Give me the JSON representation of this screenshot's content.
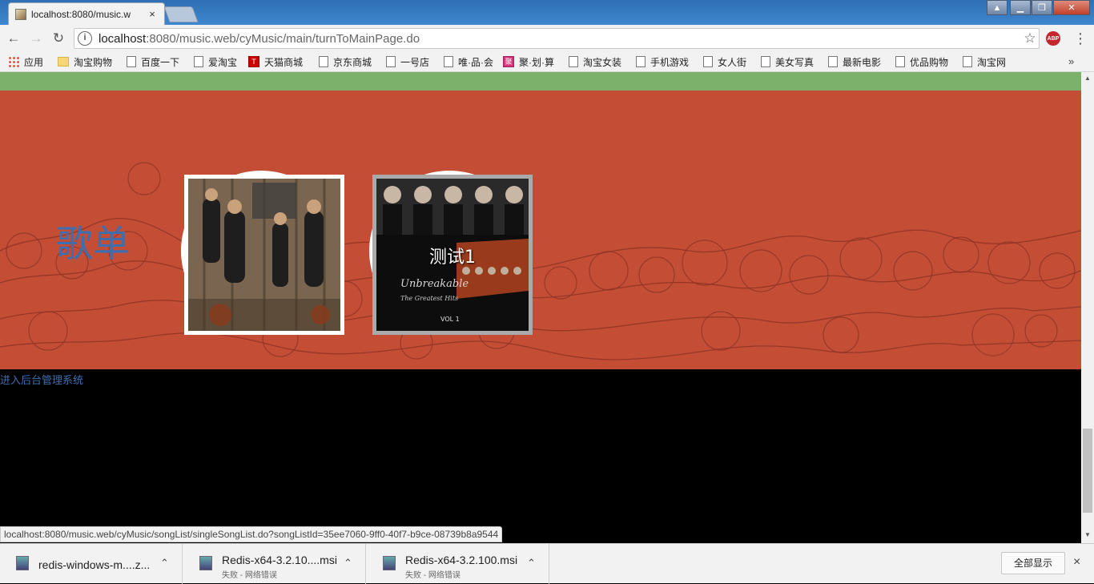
{
  "browser": {
    "tab_title": "localhost:8080/music.w",
    "tab_close": "×",
    "url_host": "localhost",
    "url_rest": ":8080/music.web/cyMusic/main/turnToMainPage.do",
    "abp_label": "ABP",
    "menu_icon": "⋮",
    "star_icon": "☆"
  },
  "bookmarks": {
    "items": [
      {
        "label": "应用",
        "icon": "apps-icon"
      },
      {
        "label": "淘宝购物",
        "icon": "folder-icon"
      },
      {
        "label": "百度一下",
        "icon": "page-icon"
      },
      {
        "label": "爱淘宝",
        "icon": "page-icon"
      },
      {
        "label": "天猫商城",
        "icon": "tmall-icon"
      },
      {
        "label": "京东商城",
        "icon": "page-icon"
      },
      {
        "label": "一号店",
        "icon": "page-icon"
      },
      {
        "label": "唯·品·会",
        "icon": "page-icon"
      },
      {
        "label": "聚·划·算",
        "icon": "juhuasuan-icon"
      },
      {
        "label": "淘宝女装",
        "icon": "page-icon"
      },
      {
        "label": "手机游戏",
        "icon": "page-icon"
      },
      {
        "label": "女人街",
        "icon": "page-icon"
      },
      {
        "label": "美女写真",
        "icon": "page-icon"
      },
      {
        "label": "最新电影",
        "icon": "page-icon"
      },
      {
        "label": "优品购物",
        "icon": "page-icon"
      },
      {
        "label": "淘宝网",
        "icon": "page-icon"
      }
    ],
    "more": "»"
  },
  "page": {
    "section_title": "歌单",
    "playlists": [
      {
        "label": ""
      },
      {
        "label": "测试1"
      }
    ],
    "admin_link": "进入后台管理系统"
  },
  "status_url": "localhost:8080/music.web/cyMusic/songList/singleSongList.do?songListId=35ee7060-9ff0-40f7-b9ce-08739b8a9544",
  "downloads": {
    "items": [
      {
        "name": "redis-windows-m....z...",
        "status": ""
      },
      {
        "name": "Redis-x64-3.2.10....msi",
        "status": "失败 - 网络错误"
      },
      {
        "name": "Redis-x64-3.2.100.msi",
        "status": "失败 - 网络错误"
      }
    ],
    "show_all": "全部显示",
    "close": "×"
  },
  "colors": {
    "hero_bg": "#c44d36",
    "green_bar": "#7cb16c",
    "link": "#3c6fb0"
  }
}
